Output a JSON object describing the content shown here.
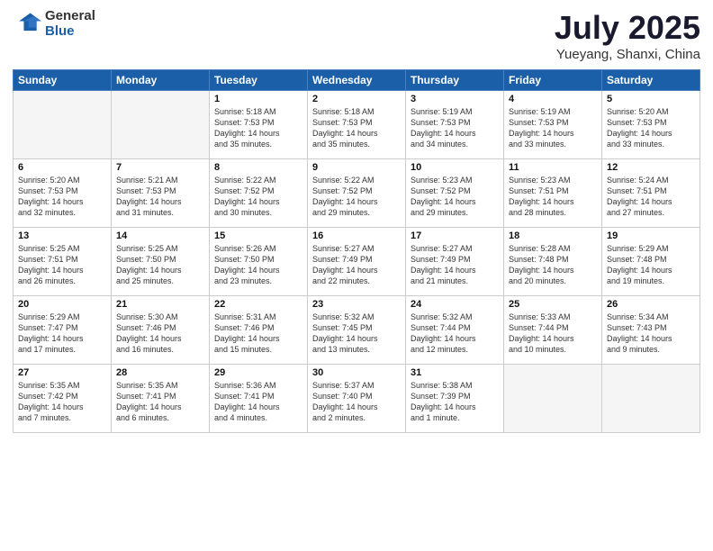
{
  "logo": {
    "general": "General",
    "blue": "Blue"
  },
  "title": "July 2025",
  "subtitle": "Yueyang, Shanxi, China",
  "days": [
    "Sunday",
    "Monday",
    "Tuesday",
    "Wednesday",
    "Thursday",
    "Friday",
    "Saturday"
  ],
  "weeks": [
    [
      {
        "num": "",
        "info": ""
      },
      {
        "num": "",
        "info": ""
      },
      {
        "num": "1",
        "info": "Sunrise: 5:18 AM\nSunset: 7:53 PM\nDaylight: 14 hours\nand 35 minutes."
      },
      {
        "num": "2",
        "info": "Sunrise: 5:18 AM\nSunset: 7:53 PM\nDaylight: 14 hours\nand 35 minutes."
      },
      {
        "num": "3",
        "info": "Sunrise: 5:19 AM\nSunset: 7:53 PM\nDaylight: 14 hours\nand 34 minutes."
      },
      {
        "num": "4",
        "info": "Sunrise: 5:19 AM\nSunset: 7:53 PM\nDaylight: 14 hours\nand 33 minutes."
      },
      {
        "num": "5",
        "info": "Sunrise: 5:20 AM\nSunset: 7:53 PM\nDaylight: 14 hours\nand 33 minutes."
      }
    ],
    [
      {
        "num": "6",
        "info": "Sunrise: 5:20 AM\nSunset: 7:53 PM\nDaylight: 14 hours\nand 32 minutes."
      },
      {
        "num": "7",
        "info": "Sunrise: 5:21 AM\nSunset: 7:53 PM\nDaylight: 14 hours\nand 31 minutes."
      },
      {
        "num": "8",
        "info": "Sunrise: 5:22 AM\nSunset: 7:52 PM\nDaylight: 14 hours\nand 30 minutes."
      },
      {
        "num": "9",
        "info": "Sunrise: 5:22 AM\nSunset: 7:52 PM\nDaylight: 14 hours\nand 29 minutes."
      },
      {
        "num": "10",
        "info": "Sunrise: 5:23 AM\nSunset: 7:52 PM\nDaylight: 14 hours\nand 29 minutes."
      },
      {
        "num": "11",
        "info": "Sunrise: 5:23 AM\nSunset: 7:51 PM\nDaylight: 14 hours\nand 28 minutes."
      },
      {
        "num": "12",
        "info": "Sunrise: 5:24 AM\nSunset: 7:51 PM\nDaylight: 14 hours\nand 27 minutes."
      }
    ],
    [
      {
        "num": "13",
        "info": "Sunrise: 5:25 AM\nSunset: 7:51 PM\nDaylight: 14 hours\nand 26 minutes."
      },
      {
        "num": "14",
        "info": "Sunrise: 5:25 AM\nSunset: 7:50 PM\nDaylight: 14 hours\nand 25 minutes."
      },
      {
        "num": "15",
        "info": "Sunrise: 5:26 AM\nSunset: 7:50 PM\nDaylight: 14 hours\nand 23 minutes."
      },
      {
        "num": "16",
        "info": "Sunrise: 5:27 AM\nSunset: 7:49 PM\nDaylight: 14 hours\nand 22 minutes."
      },
      {
        "num": "17",
        "info": "Sunrise: 5:27 AM\nSunset: 7:49 PM\nDaylight: 14 hours\nand 21 minutes."
      },
      {
        "num": "18",
        "info": "Sunrise: 5:28 AM\nSunset: 7:48 PM\nDaylight: 14 hours\nand 20 minutes."
      },
      {
        "num": "19",
        "info": "Sunrise: 5:29 AM\nSunset: 7:48 PM\nDaylight: 14 hours\nand 19 minutes."
      }
    ],
    [
      {
        "num": "20",
        "info": "Sunrise: 5:29 AM\nSunset: 7:47 PM\nDaylight: 14 hours\nand 17 minutes."
      },
      {
        "num": "21",
        "info": "Sunrise: 5:30 AM\nSunset: 7:46 PM\nDaylight: 14 hours\nand 16 minutes."
      },
      {
        "num": "22",
        "info": "Sunrise: 5:31 AM\nSunset: 7:46 PM\nDaylight: 14 hours\nand 15 minutes."
      },
      {
        "num": "23",
        "info": "Sunrise: 5:32 AM\nSunset: 7:45 PM\nDaylight: 14 hours\nand 13 minutes."
      },
      {
        "num": "24",
        "info": "Sunrise: 5:32 AM\nSunset: 7:44 PM\nDaylight: 14 hours\nand 12 minutes."
      },
      {
        "num": "25",
        "info": "Sunrise: 5:33 AM\nSunset: 7:44 PM\nDaylight: 14 hours\nand 10 minutes."
      },
      {
        "num": "26",
        "info": "Sunrise: 5:34 AM\nSunset: 7:43 PM\nDaylight: 14 hours\nand 9 minutes."
      }
    ],
    [
      {
        "num": "27",
        "info": "Sunrise: 5:35 AM\nSunset: 7:42 PM\nDaylight: 14 hours\nand 7 minutes."
      },
      {
        "num": "28",
        "info": "Sunrise: 5:35 AM\nSunset: 7:41 PM\nDaylight: 14 hours\nand 6 minutes."
      },
      {
        "num": "29",
        "info": "Sunrise: 5:36 AM\nSunset: 7:41 PM\nDaylight: 14 hours\nand 4 minutes."
      },
      {
        "num": "30",
        "info": "Sunrise: 5:37 AM\nSunset: 7:40 PM\nDaylight: 14 hours\nand 2 minutes."
      },
      {
        "num": "31",
        "info": "Sunrise: 5:38 AM\nSunset: 7:39 PM\nDaylight: 14 hours\nand 1 minute."
      },
      {
        "num": "",
        "info": ""
      },
      {
        "num": "",
        "info": ""
      }
    ]
  ]
}
